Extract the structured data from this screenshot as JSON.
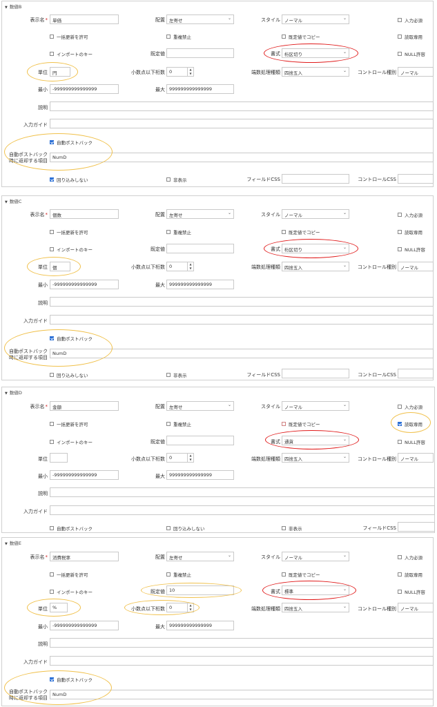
{
  "labels": {
    "display_name": "表示名",
    "placement": "配置",
    "style": "スタイル",
    "required": "入力必須",
    "allow_bulk_update": "一括更新を許可",
    "no_duplicates": "重複禁止",
    "copy_default": "既定値でコピー",
    "read_only": "読取専用",
    "import_key": "インポートのキー",
    "default_value": "既定値",
    "format": "書式",
    "null_allowed": "NULL許容",
    "unit": "単位",
    "decimal_places": "小数点以下桁数",
    "rounding_type": "端数処理種類",
    "control_type": "コントロール種別",
    "min": "最小",
    "max": "最大",
    "description": "説明",
    "input_guide": "入力ガイド",
    "auto_postback": "自動ポストバック",
    "postback_items_line1": "自動ポストバック",
    "postback_items_line2": "時に返却する項目",
    "no_wrap": "回り込みしない",
    "hidden": "非表示",
    "field_css": "フィールドCSS",
    "control_css": "コントロールCSS"
  },
  "panels": [
    {
      "title": "数値B",
      "display_name": "単価",
      "placement": "左寄せ",
      "style": "ノーマル",
      "default_value": "",
      "format": "桁区切り",
      "unit": "円",
      "decimal_places": "0",
      "rounding": "四捨五入",
      "control_type": "ノーマル",
      "min": "-999999999999999",
      "max": "999999999999999",
      "description": "",
      "input_guide": "",
      "postback_items": "NumD",
      "field_css": "",
      "control_css": ""
    },
    {
      "title": "数値C",
      "display_name": "個数",
      "placement": "左寄せ",
      "style": "ノーマル",
      "default_value": "",
      "format": "桁区切り",
      "unit": "個",
      "decimal_places": "0",
      "rounding": "四捨五入",
      "control_type": "ノーマル",
      "min": "-999999999999999",
      "max": "999999999999999",
      "description": "",
      "input_guide": "",
      "postback_items": "NumD",
      "field_css": "",
      "control_css": ""
    },
    {
      "title": "数値D",
      "display_name": "金額",
      "placement": "左寄せ",
      "style": "ノーマル",
      "default_value": "",
      "format": "通貨",
      "unit": "",
      "decimal_places": "0",
      "rounding": "四捨五入",
      "control_type": "ノーマル",
      "min": "-999999999999999",
      "max": "999999999999999",
      "description": "",
      "input_guide": "",
      "field_css": ""
    },
    {
      "title": "数値E",
      "display_name": "消費税率",
      "placement": "左寄せ",
      "style": "ノーマル",
      "default_value": "10",
      "format": "標準",
      "unit": "%",
      "decimal_places": "0",
      "rounding": "四捨五入",
      "control_type": "ノーマル",
      "min": "-999999999999999",
      "max": "999999999999999",
      "description": "",
      "input_guide": "",
      "postback_items": "NumD"
    }
  ],
  "colors": {
    "highlight_red": "#e01818",
    "highlight_yellow": "#f0c04a",
    "checkbox_checked": "#2a6fd6"
  },
  "icons": {
    "dropdown": "chevron-down-icon",
    "spinner": "number-spinner-icon",
    "collapse": "collapse-triangle-icon"
  }
}
